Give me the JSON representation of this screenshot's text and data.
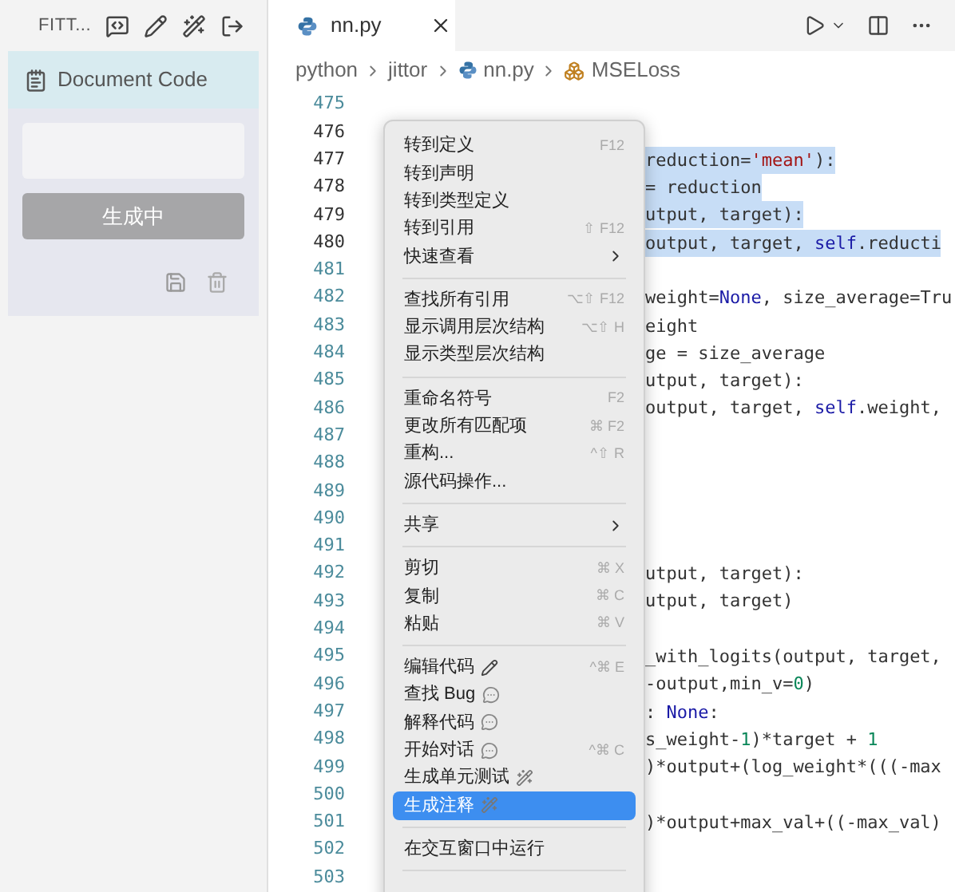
{
  "sidebar": {
    "tab_label": "FITT...",
    "panel_title": "Document Code",
    "button": {
      "label": "生成中",
      "disabled": true
    }
  },
  "editor": {
    "tab": {
      "label": "nn.py",
      "selected": true
    },
    "breadcrumb": [
      "python",
      "jittor",
      "nn.py",
      "MSELoss"
    ],
    "lines": [
      {
        "number": "475",
        "selected": false
      },
      {
        "number": "476",
        "selected": true
      },
      {
        "number": "477",
        "selected": true,
        "segments": [
          {
            "text": "reduction=",
            "kind": "plain"
          },
          {
            "text": "'mean'",
            "kind": "string"
          },
          {
            "text": "):",
            "kind": "plain"
          }
        ]
      },
      {
        "number": "478",
        "selected": true,
        "segments": [
          {
            "text": "= reduction",
            "kind": "plain"
          }
        ]
      },
      {
        "number": "479",
        "selected": true,
        "segments": [
          {
            "text": "utput, target):",
            "kind": "plain"
          }
        ]
      },
      {
        "number": "480",
        "selected": true,
        "segments": [
          {
            "text": "output, target, ",
            "kind": "plain"
          },
          {
            "text": "self",
            "kind": "keyword"
          },
          {
            "text": ".reducti",
            "kind": "plain"
          }
        ]
      },
      {
        "number": "481",
        "selected": false
      },
      {
        "number": "482",
        "selected": false,
        "segments": [
          {
            "text": "weight=",
            "kind": "plain"
          },
          {
            "text": "None",
            "kind": "keyword"
          },
          {
            "text": ", size_average=Tru",
            "kind": "plain"
          }
        ]
      },
      {
        "number": "483",
        "selected": false,
        "segments": [
          {
            "text": "eight",
            "kind": "plain"
          }
        ]
      },
      {
        "number": "484",
        "selected": false,
        "segments": [
          {
            "text": "ge = size_average",
            "kind": "plain"
          }
        ]
      },
      {
        "number": "485",
        "selected": false,
        "segments": [
          {
            "text": "utput, target):",
            "kind": "plain"
          }
        ]
      },
      {
        "number": "486",
        "selected": false,
        "segments": [
          {
            "text": "output, target, ",
            "kind": "plain"
          },
          {
            "text": "self",
            "kind": "keyword"
          },
          {
            "text": ".weight,",
            "kind": "plain"
          }
        ]
      },
      {
        "number": "487",
        "selected": false
      },
      {
        "number": "488",
        "selected": false
      },
      {
        "number": "489",
        "selected": false
      },
      {
        "number": "490",
        "selected": false
      },
      {
        "number": "491",
        "selected": false
      },
      {
        "number": "492",
        "selected": false,
        "segments": [
          {
            "text": "utput, target):",
            "kind": "plain"
          }
        ]
      },
      {
        "number": "493",
        "selected": false,
        "segments": [
          {
            "text": "utput, target)",
            "kind": "plain"
          }
        ]
      },
      {
        "number": "494",
        "selected": false
      },
      {
        "number": "495",
        "selected": false,
        "segments": [
          {
            "text": "_with_logits(output, target,",
            "kind": "plain"
          }
        ]
      },
      {
        "number": "496",
        "selected": false,
        "segments": [
          {
            "text": "-output,min_v=",
            "kind": "plain"
          },
          {
            "text": "0",
            "kind": "number"
          },
          {
            "text": ")",
            "kind": "plain"
          }
        ]
      },
      {
        "number": "497",
        "selected": false,
        "segments": [
          {
            "text": ": ",
            "kind": "plain"
          },
          {
            "text": "None",
            "kind": "keyword"
          },
          {
            "text": ":",
            "kind": "plain"
          }
        ]
      },
      {
        "number": "498",
        "selected": false,
        "segments": [
          {
            "text": "s_weight-",
            "kind": "plain"
          },
          {
            "text": "1",
            "kind": "number"
          },
          {
            "text": ")*target + ",
            "kind": "plain"
          },
          {
            "text": "1",
            "kind": "number"
          }
        ]
      },
      {
        "number": "499",
        "selected": false,
        "segments": [
          {
            "text": ")*output+(log_weight*(((-max",
            "kind": "plain"
          }
        ]
      },
      {
        "number": "500",
        "selected": false
      },
      {
        "number": "501",
        "selected": false,
        "segments": [
          {
            "text": ")*output+max_val+((-max_val)",
            "kind": "plain"
          }
        ]
      },
      {
        "number": "502",
        "selected": false
      },
      {
        "number": "503",
        "selected": false
      }
    ]
  },
  "context_menu": [
    {
      "kind": "item",
      "label": "转到定义",
      "shortcut": "F12",
      "selected": false
    },
    {
      "kind": "item",
      "label": "转到声明",
      "selected": false
    },
    {
      "kind": "item",
      "label": "转到类型定义",
      "selected": false
    },
    {
      "kind": "item",
      "label": "转到引用",
      "shortcut": "⇧ F12",
      "selected": false
    },
    {
      "kind": "submenu",
      "label": "快速查看",
      "selected": false
    },
    {
      "kind": "separator"
    },
    {
      "kind": "item",
      "label": "查找所有引用",
      "shortcut": "⌥⇧ F12",
      "selected": false
    },
    {
      "kind": "item",
      "label": "显示调用层次结构",
      "shortcut": "⌥⇧ H",
      "selected": false
    },
    {
      "kind": "item",
      "label": "显示类型层次结构",
      "selected": false
    },
    {
      "kind": "separator"
    },
    {
      "kind": "item",
      "label": "重命名符号",
      "shortcut": "F2",
      "selected": false
    },
    {
      "kind": "item",
      "label": "更改所有匹配项",
      "shortcut": "⌘ F2",
      "selected": false
    },
    {
      "kind": "item",
      "label": "重构...",
      "shortcut": "^⇧ R",
      "selected": false
    },
    {
      "kind": "item",
      "label": "源代码操作...",
      "selected": false
    },
    {
      "kind": "separator"
    },
    {
      "kind": "submenu",
      "label": "共享",
      "selected": false
    },
    {
      "kind": "separator"
    },
    {
      "kind": "item",
      "label": "剪切",
      "shortcut": "⌘ X",
      "selected": false
    },
    {
      "kind": "item",
      "label": "复制",
      "shortcut": "⌘ C",
      "selected": false
    },
    {
      "kind": "item",
      "label": "粘贴",
      "shortcut": "⌘ V",
      "selected": false
    },
    {
      "kind": "separator"
    },
    {
      "kind": "pen_item",
      "label": "编辑代码",
      "shortcut": "^⌘ E",
      "selected": false
    },
    {
      "kind": "chat_item",
      "label": "查找 Bug",
      "selected": false
    },
    {
      "kind": "chat_item",
      "label": "解释代码",
      "selected": false
    },
    {
      "kind": "chat_item",
      "label": "开始对话",
      "shortcut": "^⌘ C",
      "selected": false
    },
    {
      "kind": "wand_item",
      "label": "生成单元测试",
      "selected": false
    },
    {
      "kind": "wand_item",
      "label": "生成注释",
      "selected": true
    },
    {
      "kind": "separator"
    },
    {
      "kind": "item",
      "label": "在交互窗口中运行",
      "selected": false
    },
    {
      "kind": "separator"
    }
  ]
}
